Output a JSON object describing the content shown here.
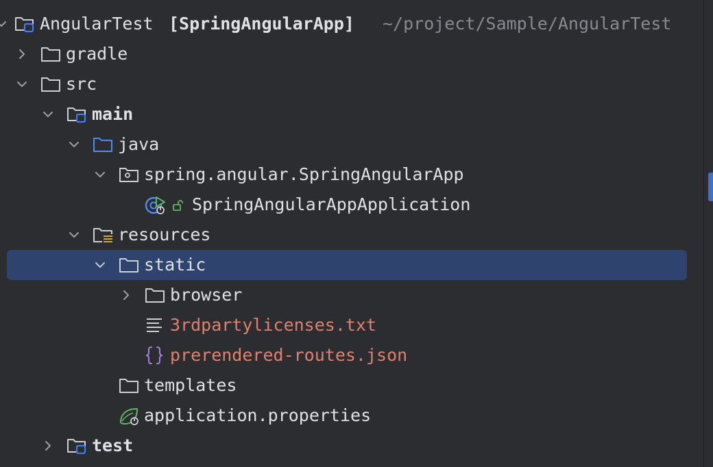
{
  "project": {
    "name": "AngularTest",
    "module": "[SpringAngularApp]",
    "path": "~/project/Sample/AngularTest"
  },
  "items": {
    "gradle": "gradle",
    "src": "src",
    "main": "main",
    "java": "java",
    "package": "spring.angular.SpringAngularApp",
    "app_class": "SpringAngularAppApplication",
    "resources": "resources",
    "static": "static",
    "browser": "browser",
    "licenses": "3rdpartylicenses.txt",
    "routes": "prerendered-routes.json",
    "templates": "templates",
    "properties": "application.properties",
    "test": "test"
  },
  "colors": {
    "background": "#2b2d30",
    "selection": "#2e436e",
    "text": "#dfe1e5",
    "path_text": "#868a91",
    "unversioned_file": "#e0806e",
    "module_blue": "#3d7cf5",
    "spring_green": "#5fb85f",
    "json_purple": "#b07ae8"
  },
  "icons": {
    "folder": "folder-icon",
    "module_folder": "module-folder-icon",
    "source_root": "source-root-folder-icon",
    "package": "package-icon",
    "spring_app": "spring-boot-app-icon",
    "resources_root": "resources-root-folder-icon",
    "text_file": "text-file-icon",
    "json_file": "json-file-icon",
    "spring_properties": "spring-properties-icon",
    "test_module": "test-module-folder-icon"
  }
}
